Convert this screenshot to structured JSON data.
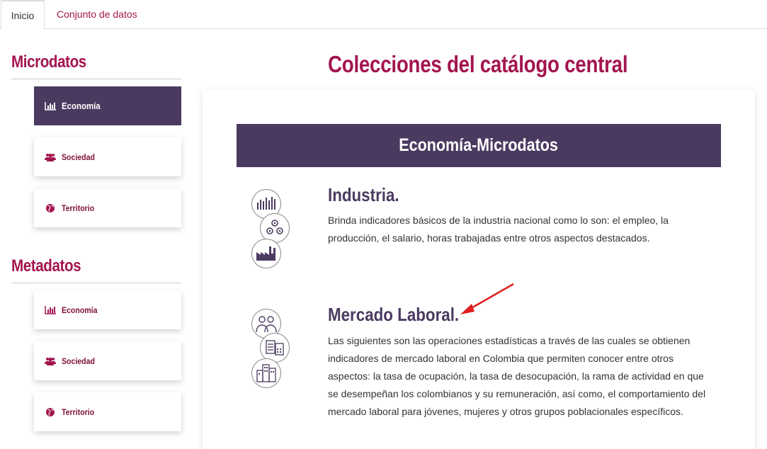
{
  "tabs": {
    "home": "Inicio",
    "dataset": "Conjunto de datos"
  },
  "sidebar": {
    "microdatos": {
      "heading": "Microdatos",
      "items": [
        {
          "label": "Economía",
          "icon": "bar-chart-icon"
        },
        {
          "label": "Sociedad",
          "icon": "users-icon"
        },
        {
          "label": "Territorio",
          "icon": "globe-icon"
        }
      ]
    },
    "metadatos": {
      "heading": "Metadatos",
      "items": [
        {
          "label": "Economía",
          "icon": "bar-chart-icon"
        },
        {
          "label": "Sociedad",
          "icon": "users-icon"
        },
        {
          "label": "Territorio",
          "icon": "globe-icon"
        }
      ]
    }
  },
  "main": {
    "title": "Colecciones del catálogo central",
    "banner": "Economía-Microdatos",
    "blocks": [
      {
        "title": "Industria.",
        "text": "Brinda indicadores básicos de la industria nacional como lo son: el empleo, la producción, el salario, horas trabajadas entre otros aspectos destacados."
      },
      {
        "title": "Mercado Laboral.",
        "text": "Las siguientes son las operaciones estadísticas a través de las cuales se obtienen indicadores de mercado laboral en Colombia que permiten conocer entre otros aspectos: la tasa de ocupación, la tasa de desocupación, la rama de actividad en que se desempeñan los colombianos y su remuneración, así como, el comportamiento del mercado laboral para jóvenes, mujeres y otros grupos poblacionales específicos."
      }
    ]
  },
  "colors": {
    "accent": "#a3154f",
    "purple": "#4b3a60",
    "annotation_arrow": "#e02020"
  }
}
